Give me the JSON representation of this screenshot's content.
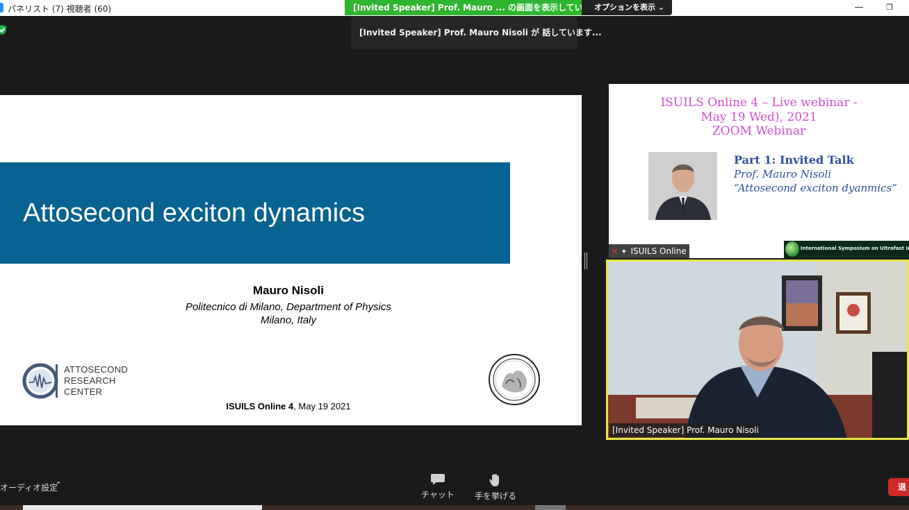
{
  "window": {
    "title": "パネリスト (7) 視聴者 (60)",
    "minimize": "—",
    "restore": "❐"
  },
  "share_banner": {
    "status": "[Invited Speaker]  Prof.  Mauro  ... の画面を表示しています",
    "options_label": "オプションを表示 ⌄"
  },
  "toast": {
    "text": "[Invited Speaker]  Prof.  Mauro  Nisoli が 話しています..."
  },
  "slide": {
    "title": "Attosecond exciton dynamics",
    "author": "Mauro  Nisoli",
    "affiliation": "Politecnico di Milano, Department of Physics",
    "location": "Milano, Italy",
    "logo_lines": [
      "ATTOSECOND",
      "RESEARCH",
      "CENTER"
    ],
    "footer_bold": "ISUILS Online 4",
    "footer_rest": ", May 19 2021",
    "band_color": "#076391"
  },
  "thumbnail": {
    "heading_lines": [
      "ISUILS Online 4 – Live webinar -",
      "May 19 Wed), 2021",
      "ZOOM Webinar"
    ],
    "part": "Part 1: Invited Talk",
    "speaker": "Prof. Mauro Nisoli",
    "talk": "“Attosecond exciton dyanmics”",
    "banner_text": "International Symposium on Ultrafast Intense Laser Science",
    "name_tag": "ISUILS Online",
    "heading_color": "#d14fcf",
    "text_color": "#2b4fa0"
  },
  "speaker_video": {
    "name_tag": "[Invited Speaker] Prof. Mauro Nisoli",
    "highlight_color": "#e6e64a"
  },
  "toolbar": {
    "audio_settings": "オーディオ設定",
    "chat": "チャット",
    "raise_hand": "手を挙げる",
    "leave": "退"
  }
}
